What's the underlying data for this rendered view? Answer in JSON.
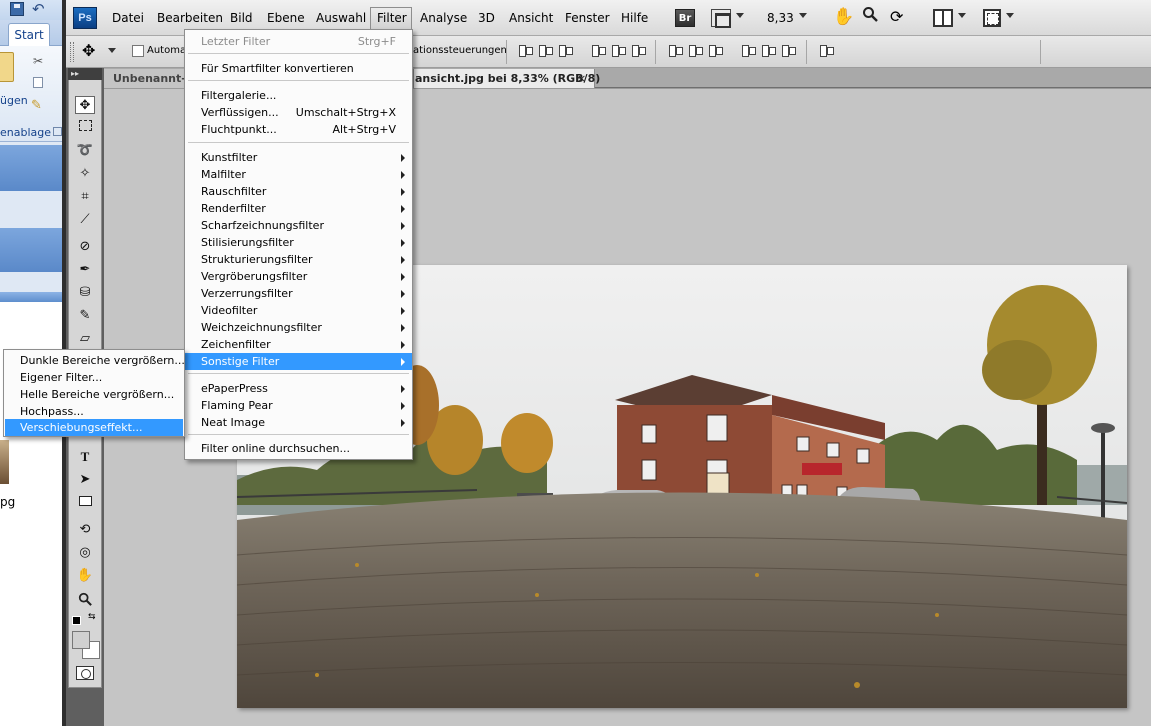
{
  "word": {
    "tab_start": "Start",
    "paste_label": "ügen",
    "group_label": "enablage",
    "filename": "pg"
  },
  "menubar": {
    "logo": "Ps",
    "items": [
      {
        "label": "Datei"
      },
      {
        "label": "Bearbeiten"
      },
      {
        "label": "Bild"
      },
      {
        "label": "Ebene"
      },
      {
        "label": "Auswahl"
      },
      {
        "label": "Filter"
      },
      {
        "label": "Analyse"
      },
      {
        "label": "3D"
      },
      {
        "label": "Ansicht"
      },
      {
        "label": "Fenster"
      },
      {
        "label": "Hilfe"
      }
    ],
    "bridge_label": "Br",
    "zoom": "8,33"
  },
  "options_bar": {
    "auto_label": "Automat",
    "controls_label": "ationssteuerungen"
  },
  "tabs": {
    "untitled": "Unbenannt-1",
    "active": "ansicht.jpg bei 8,33% (RGB/8)",
    "close": "×"
  },
  "filter_menu": {
    "items": [
      {
        "label": "Letzter Filter",
        "shortcut": "Strg+F"
      },
      {
        "label": "Für Smartfilter konvertieren"
      },
      {
        "label": "Filtergalerie..."
      },
      {
        "label": "Verflüssigen...",
        "shortcut": "Umschalt+Strg+X"
      },
      {
        "label": "Fluchtpunkt...",
        "shortcut": "Alt+Strg+V"
      },
      {
        "label": "Kunstfilter"
      },
      {
        "label": "Malfilter"
      },
      {
        "label": "Rauschfilter"
      },
      {
        "label": "Renderfilter"
      },
      {
        "label": "Scharfzeichnungsfilter"
      },
      {
        "label": "Stilisierungsfilter"
      },
      {
        "label": "Strukturierungsfilter"
      },
      {
        "label": "Vergröberungsfilter"
      },
      {
        "label": "Verzerrungsfilter"
      },
      {
        "label": "Videofilter"
      },
      {
        "label": "Weichzeichnungsfilter"
      },
      {
        "label": "Zeichenfilter"
      },
      {
        "label": "Sonstige Filter"
      },
      {
        "label": "ePaperPress"
      },
      {
        "label": "Flaming Pear"
      },
      {
        "label": "Neat Image"
      },
      {
        "label": "Filter online durchsuchen..."
      }
    ]
  },
  "submenu": {
    "items": [
      {
        "label": "Dunkle Bereiche vergrößern..."
      },
      {
        "label": "Eigener Filter..."
      },
      {
        "label": "Helle Bereiche vergrößern..."
      },
      {
        "label": "Hochpass..."
      },
      {
        "label": "Verschiebungseffekt..."
      }
    ]
  },
  "colors": {
    "highlight": "#3399ff",
    "canvas_bg": "#c5c5c5",
    "toolbox_bg": "#d6d6d6"
  }
}
